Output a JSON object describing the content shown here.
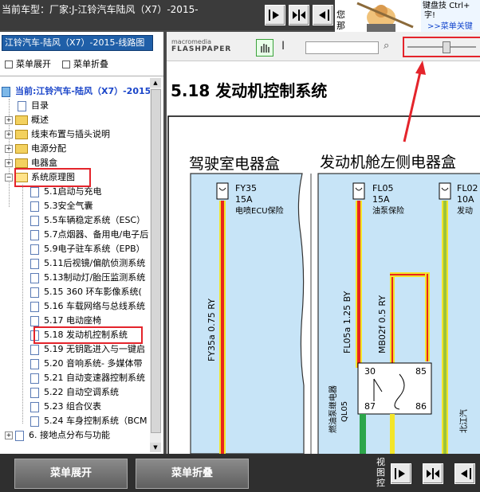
{
  "app": {
    "title": "当前车型：厂家:J-江铃汽车陆风（X7）-2015-",
    "nav_buttons": [
      "view-prev",
      "view-both",
      "view-next"
    ]
  },
  "ad": {
    "side_text": "您\n那",
    "line1": "键盘技",
    "line2": "字!",
    "line1_suffix": "Ctrl+",
    "link": ">>菜单关键"
  },
  "sidebar": {
    "header": "江铃汽车-陆风（X7）-2015-线路图",
    "expand_label": "菜单展开",
    "collapse_label": "菜单折叠",
    "current": "当前:江铃汽车-陆风（X7）-2015-线",
    "items": [
      {
        "label": "目录",
        "type": "doc"
      },
      {
        "label": "概述",
        "type": "folder"
      },
      {
        "label": "线束布置与插头说明",
        "type": "folder"
      },
      {
        "label": "电源分配",
        "type": "folder"
      },
      {
        "label": "电器盒",
        "type": "folder"
      },
      {
        "label": "系统原理图",
        "type": "folder-open"
      }
    ],
    "children": [
      "5.1启动与充电",
      "5.3安全气囊",
      "5.5车辆稳定系统（ESC）",
      "5.7点烟器、备用电/电子后",
      "5.9电子驻车系统（EPB）",
      "5.11后视镜/偏航侦测系统",
      "5.13制动灯/胎压监测系统",
      "5.15 360 环车影像系统(",
      "5.16 车载网络与总线系统",
      "5.17 电动座椅",
      "5.18 发动机控制系统",
      "5.19 无钥匙进入与一键启",
      "5.20 音响系统- 多媒体带",
      "5.21 自动变速器控制系统",
      "5.22 自动空调系统",
      "5.23 组合仪表",
      "5.24 车身控制系统（BCM"
    ],
    "last_item": "6. 接地点分布与功能"
  },
  "viewer": {
    "logo_top": "macromedia",
    "logo_bottom": "FLASHPAPER",
    "heading": "5.18 发动机控制系统"
  },
  "diagram": {
    "cab_title": "驾驶室电器盒",
    "engine_title": "发动机舱左侧电器盒",
    "fy35": {
      "name": "FY35",
      "amp": "15A",
      "desc": "电喷ECU保险",
      "wire": "FY35a 0.75 RY"
    },
    "fl05": {
      "name": "FL05",
      "amp": "15A",
      "desc": "油泵保险",
      "wire": "FL05a 1.25 BY"
    },
    "fl02": {
      "name": "FL02",
      "amp": "10A",
      "desc": "发动"
    },
    "relay": {
      "wire": "MB02f 0.5 RY",
      "pins": [
        "30",
        "85",
        "87",
        "86"
      ],
      "label": "燃油泵继电器",
      "code": "QL05"
    },
    "side_label": "北江汽"
  },
  "bottom": {
    "expand_label": "菜单展开",
    "collapse_label": "菜单折叠",
    "view_label": "视图控"
  },
  "colors": {
    "wire_red": "#e8251d",
    "wire_yellow": "#f3e529",
    "wire_green": "#2ca54a",
    "panel_blue": "#c7e4f7",
    "highlight": "#e4242b"
  }
}
